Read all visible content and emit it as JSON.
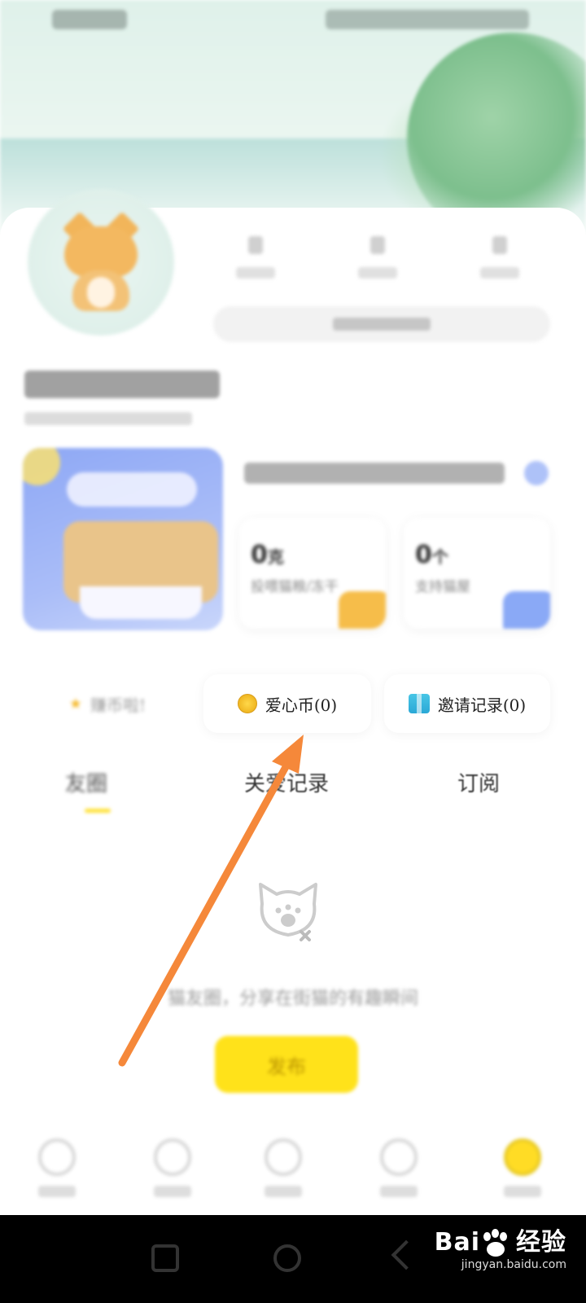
{
  "profile": {
    "stats": [
      {
        "name": "stat-following"
      },
      {
        "name": "stat-followers"
      },
      {
        "name": "stat-likes"
      }
    ]
  },
  "feature": {
    "cards": [
      {
        "value": "0",
        "unit": "克",
        "label": "投喂猫粮/冻干",
        "deco_color": "#f6bd4a"
      },
      {
        "value": "0",
        "unit": "个",
        "label": "支持猫屋",
        "deco_color": "#8aa9f6"
      }
    ]
  },
  "actions": {
    "earn_label": "赚币啦!",
    "coins_label": "爱心币(0)",
    "invite_label": "邀请记录(0)"
  },
  "tabs": [
    {
      "label": "友圈"
    },
    {
      "label": "关爱记录"
    },
    {
      "label": "订阅"
    }
  ],
  "empty_state": {
    "text": "猫友圈，分享在街猫的有趣瞬间",
    "publish_label": "发布"
  },
  "watermark": {
    "brand": "Bai",
    "brand_tail": "经验",
    "url": "jingyan.baidu.com"
  },
  "colors": {
    "accent": "#ffe21a",
    "arrow": "#f5883a"
  }
}
